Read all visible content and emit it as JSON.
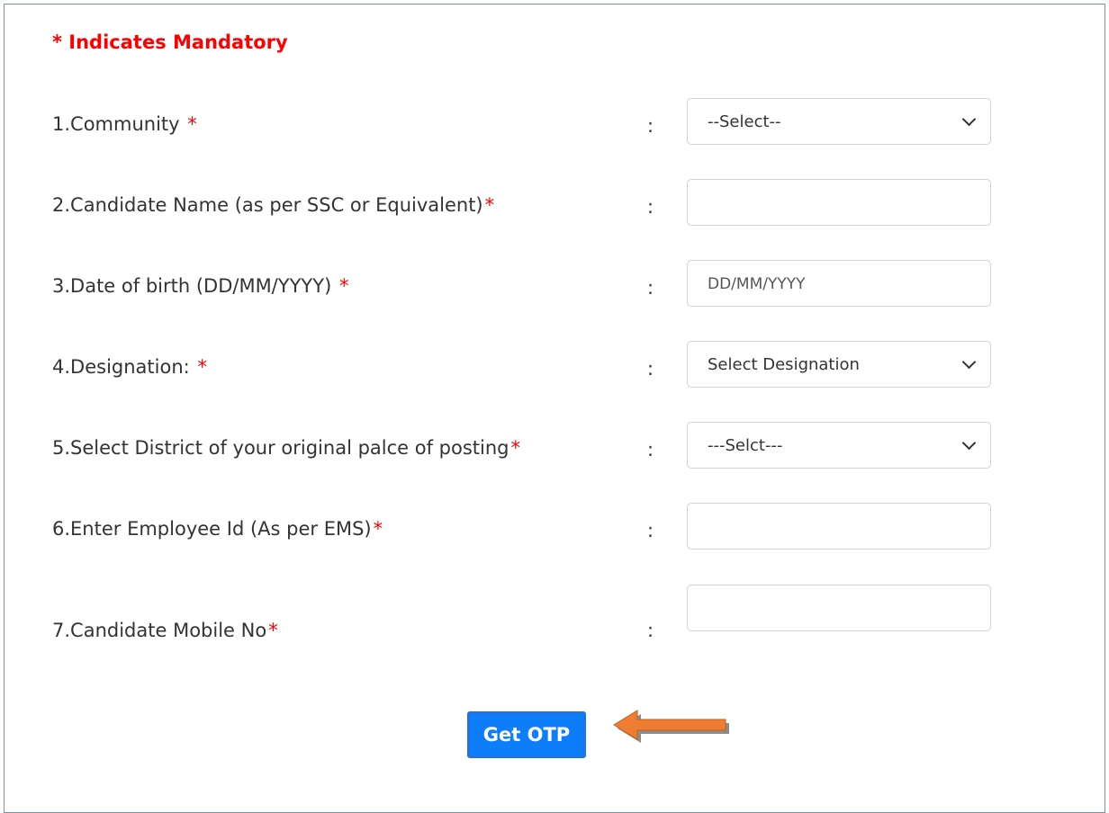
{
  "mandatory_note": "* Indicates Mandatory",
  "colon": ":",
  "fields": [
    {
      "label": "1.Community ",
      "star": "*",
      "type": "select",
      "value": "--Select--"
    },
    {
      "label": "2.Candidate Name (as per SSC or Equivalent)",
      "star": "*",
      "type": "text",
      "value": ""
    },
    {
      "label": "3.Date of birth (DD/MM/YYYY) ",
      "star": "*",
      "type": "text",
      "value": "",
      "placeholder": "DD/MM/YYYY"
    },
    {
      "label": "4.Designation: ",
      "star": "*",
      "type": "select",
      "value": "Select Designation"
    },
    {
      "label": "5.Select District of your original palce of posting",
      "star": "*",
      "type": "select",
      "value": "---Selct---"
    },
    {
      "label": "6.Enter Employee Id (As per EMS)",
      "star": "*",
      "type": "text",
      "value": ""
    },
    {
      "label": "7.Candidate Mobile No",
      "star": "*",
      "type": "text",
      "value": ""
    }
  ],
  "button": {
    "label": "Get OTP",
    "color": "#0d7dfa"
  },
  "colors": {
    "required": "#ff0000",
    "arrow": "#ee7d32"
  },
  "icons": {
    "select_arrow": "chevron-down-icon",
    "pointer": "arrow-left-icon"
  }
}
